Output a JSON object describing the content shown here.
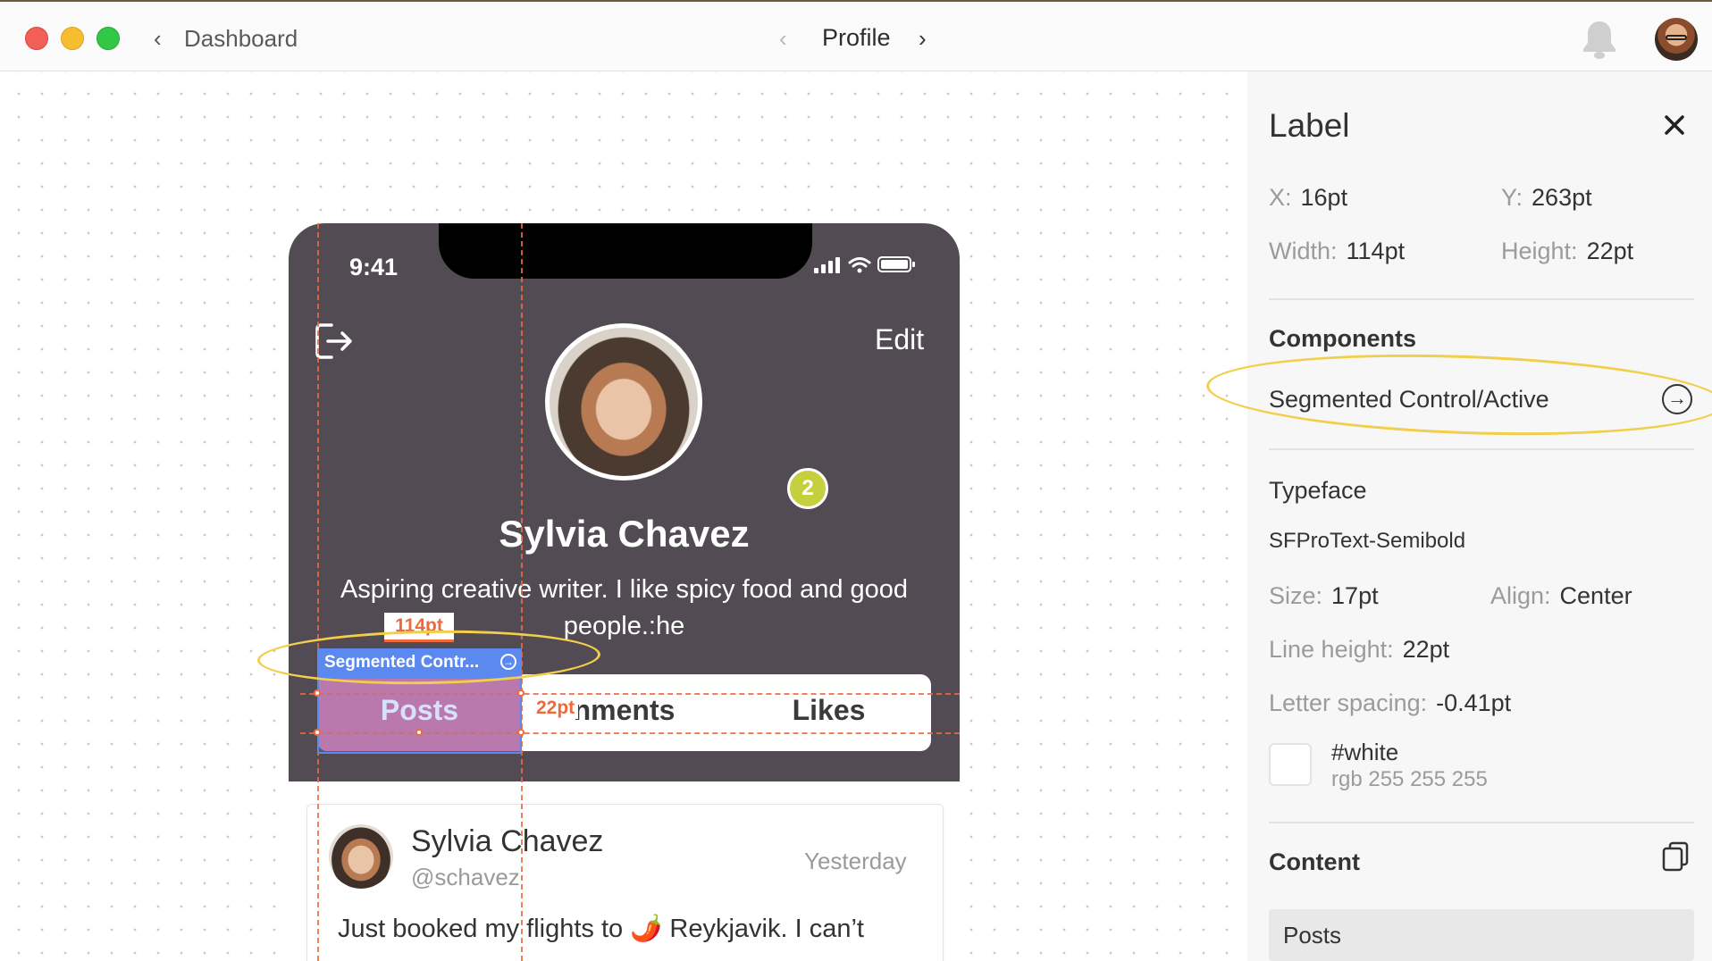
{
  "toolbar": {
    "back_label": "Dashboard",
    "page_title": "Profile"
  },
  "phone": {
    "time": "9:41",
    "edit_label": "Edit",
    "badge_count": "2",
    "name": "Sylvia Chavez",
    "bio": "Aspiring creative writer. I like spicy food and good people.:he",
    "segments": [
      "Posts",
      "nments",
      "Likes"
    ],
    "post": {
      "name": "Sylvia Chavez",
      "handle": "@schavez",
      "time": "Yesterday",
      "text": "Just booked my flights to 🌶️ Reykjavik. I can’t"
    }
  },
  "overlay": {
    "component_tag": "Segmented Contr...",
    "width_tag": "114pt",
    "height_tag": "22pt",
    "highlight_color": "#f2ce4a",
    "measure_color": "#ee6a3c",
    "selection_color": "#5b89f0"
  },
  "panel": {
    "title": "Label",
    "x_label": "X:",
    "x_value": "16pt",
    "y_label": "Y:",
    "y_value": "263pt",
    "width_label": "Width:",
    "width_value": "114pt",
    "height_label": "Height:",
    "height_value": "22pt",
    "components_heading": "Components",
    "component_name": "Segmented Control/Active",
    "typeface_heading": "Typeface",
    "typeface_value": "SFProText-Semibold",
    "size_label": "Size:",
    "size_value": "17pt",
    "align_label": "Align:",
    "align_value": "Center",
    "line_height_label": "Line height:",
    "line_height_value": "22pt",
    "letter_spacing_label": "Letter spacing:",
    "letter_spacing_value": "-0.41pt",
    "color_name": "#white",
    "color_rgb": "rgb 255 255 255",
    "content_heading": "Content",
    "content_value": "Posts"
  },
  "colors": {
    "header_bg": "#524b53",
    "active_segment": "#d97497",
    "badge": "#c6cf3e"
  }
}
